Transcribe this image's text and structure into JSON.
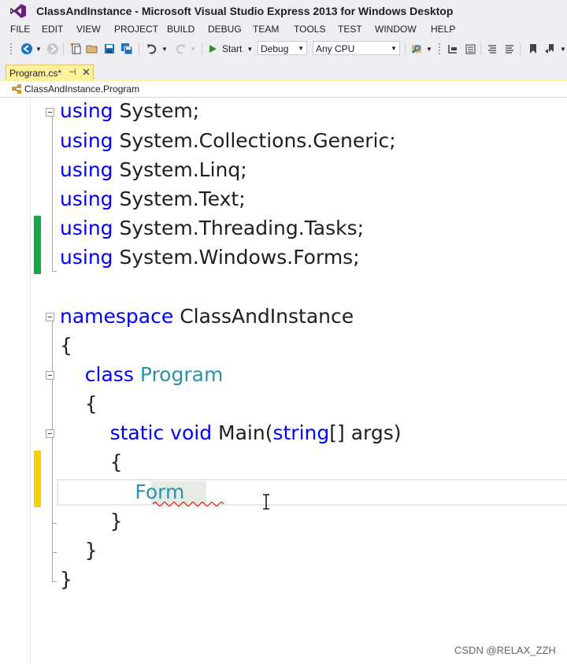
{
  "window": {
    "title": "ClassAndInstance - Microsoft Visual Studio Express 2013 for Windows Desktop"
  },
  "menu": [
    "FILE",
    "EDIT",
    "VIEW",
    "PROJECT",
    "BUILD",
    "DEBUG",
    "TEAM",
    "TOOLS",
    "TEST",
    "WINDOW",
    "HELP"
  ],
  "toolbar": {
    "start_label": "Start",
    "configuration": "Debug",
    "platform": "Any CPU"
  },
  "tabs": [
    {
      "label": "Program.cs*",
      "active": true
    }
  ],
  "navbar": {
    "member": "ClassAndInstance.Program"
  },
  "editor": {
    "lines": [
      [
        {
          "t": "using",
          "k": "kw"
        },
        {
          "t": " System;",
          "k": "plain"
        }
      ],
      [
        {
          "t": "using",
          "k": "kw"
        },
        {
          "t": " System.Collections.Generic;",
          "k": "plain"
        }
      ],
      [
        {
          "t": "using",
          "k": "kw"
        },
        {
          "t": " System.Linq;",
          "k": "plain"
        }
      ],
      [
        {
          "t": "using",
          "k": "kw"
        },
        {
          "t": " System.Text;",
          "k": "plain"
        }
      ],
      [
        {
          "t": "using",
          "k": "kw"
        },
        {
          "t": " System.Threading.Tasks;",
          "k": "plain"
        }
      ],
      [
        {
          "t": "using",
          "k": "kw"
        },
        {
          "t": " System.Windows.Forms;",
          "k": "plain"
        }
      ],
      [],
      [
        {
          "t": "namespace",
          "k": "kw"
        },
        {
          "t": " ClassAndInstance",
          "k": "plain"
        }
      ],
      [
        {
          "t": "{",
          "k": "plain"
        }
      ],
      [
        {
          "t": "    ",
          "k": "plain"
        },
        {
          "t": "class",
          "k": "kw"
        },
        {
          "t": " ",
          "k": "plain"
        },
        {
          "t": "Program",
          "k": "type"
        }
      ],
      [
        {
          "t": "    {",
          "k": "plain"
        }
      ],
      [
        {
          "t": "        ",
          "k": "plain"
        },
        {
          "t": "static",
          "k": "kw"
        },
        {
          "t": " ",
          "k": "plain"
        },
        {
          "t": "void",
          "k": "kw"
        },
        {
          "t": " Main(",
          "k": "plain"
        },
        {
          "t": "string",
          "k": "kw"
        },
        {
          "t": "[] args)",
          "k": "plain"
        }
      ],
      [
        {
          "t": "        {",
          "k": "plain"
        }
      ],
      [
        {
          "t": "            ",
          "k": "plain"
        },
        {
          "t": "Form",
          "k": "type"
        }
      ],
      [
        {
          "t": "        }",
          "k": "plain"
        }
      ],
      [
        {
          "t": "    }",
          "k": "plain"
        }
      ],
      [
        {
          "t": "}",
          "k": "plain"
        }
      ]
    ],
    "error_word": "Form"
  },
  "colors": {
    "keyword": "#0000ff",
    "type": "#2b91af",
    "text": "#1e1e1e",
    "saved_change": "#14a84a",
    "unsaved_change": "#f7d000",
    "active_tab": "#fff29d"
  },
  "watermark": "CSDN @RELAX_ZZH"
}
